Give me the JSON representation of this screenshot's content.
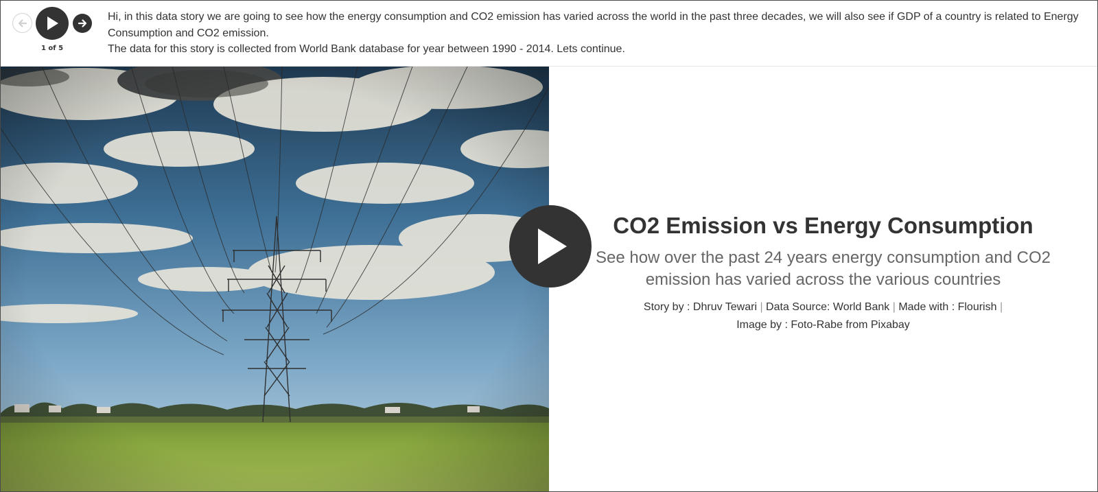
{
  "navigation": {
    "progress_text": "1 of 5",
    "prev_icon": "arrow-left-icon",
    "play_icon": "play-icon",
    "next_icon": "arrow-right-icon"
  },
  "caption": {
    "line1": "Hi, in this data story we are going to see how the energy consumption and CO2 emission has varied across the world in the past three decades, we will also see if GDP of a country is related to Energy Consumption and CO2 emission.",
    "line2": "The data for this story is collected from World Bank database for year between 1990 - 2014. Lets continue."
  },
  "slide": {
    "title": "CO2 Emission vs Energy Consumption",
    "subtitle": "See how over the past 24 years energy consumption and CO2 emission has varied across the various countries",
    "credits": {
      "story_by_label": "Story by : ",
      "story_by_name": "Dhruv Tewari",
      "separator": " | ",
      "data_source_label": "Data Source: ",
      "data_source_name": "World Bank",
      "made_with_label": "Made with : ",
      "made_with_name": "Flourish",
      "image_by_label": "Image by : ",
      "image_by_name": "Foto-Rabe from Pixabay"
    },
    "play_overlay_icon": "play-icon"
  },
  "colors": {
    "dark": "#333333",
    "muted_text": "#666666",
    "sky_top": "#1f3a52",
    "sky_mid": "#5b8fb8",
    "field": "#8aa840"
  }
}
